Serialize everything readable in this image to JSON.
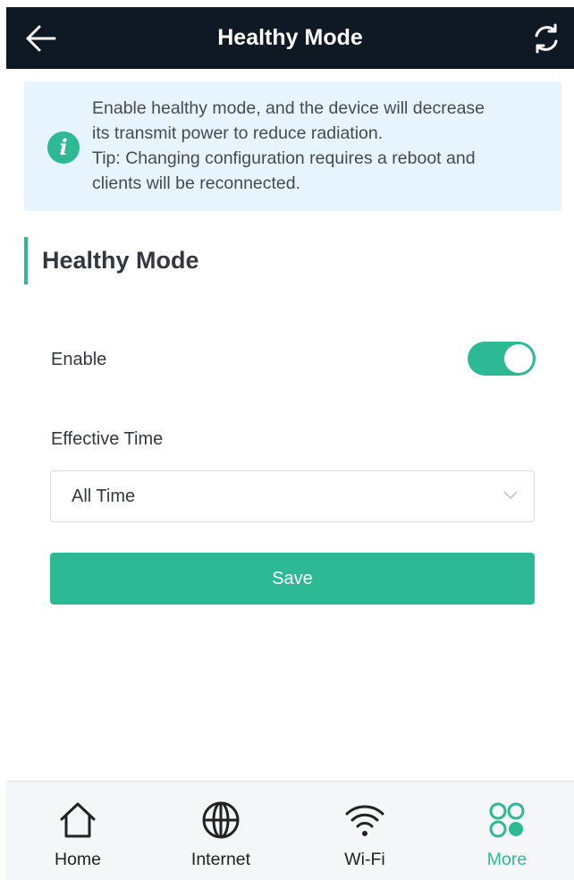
{
  "header": {
    "title": "Healthy Mode",
    "back_icon": "back-arrow-icon",
    "refresh_icon": "refresh-icon"
  },
  "notice": {
    "icon": "info-icon",
    "icon_glyph": "i",
    "line1": "Enable healthy mode, and the device will decrease",
    "line2": "its transmit power to reduce radiation.",
    "line3": "Tip: Changing configuration requires a reboot and",
    "line4": "clients will be reconnected."
  },
  "section": {
    "title": "Healthy Mode"
  },
  "form": {
    "enable_label": "Enable",
    "enable_on": true,
    "effective_time_label": "Effective Time",
    "effective_time_value": "All Time",
    "save_label": "Save"
  },
  "bottom_nav": {
    "home": "Home",
    "internet": "Internet",
    "wifi": "Wi-Fi",
    "more": "More",
    "active": "More"
  },
  "colors": {
    "accent": "#2eb995",
    "header_bg": "#0f1923",
    "notice_bg": "#e8f4fd"
  }
}
